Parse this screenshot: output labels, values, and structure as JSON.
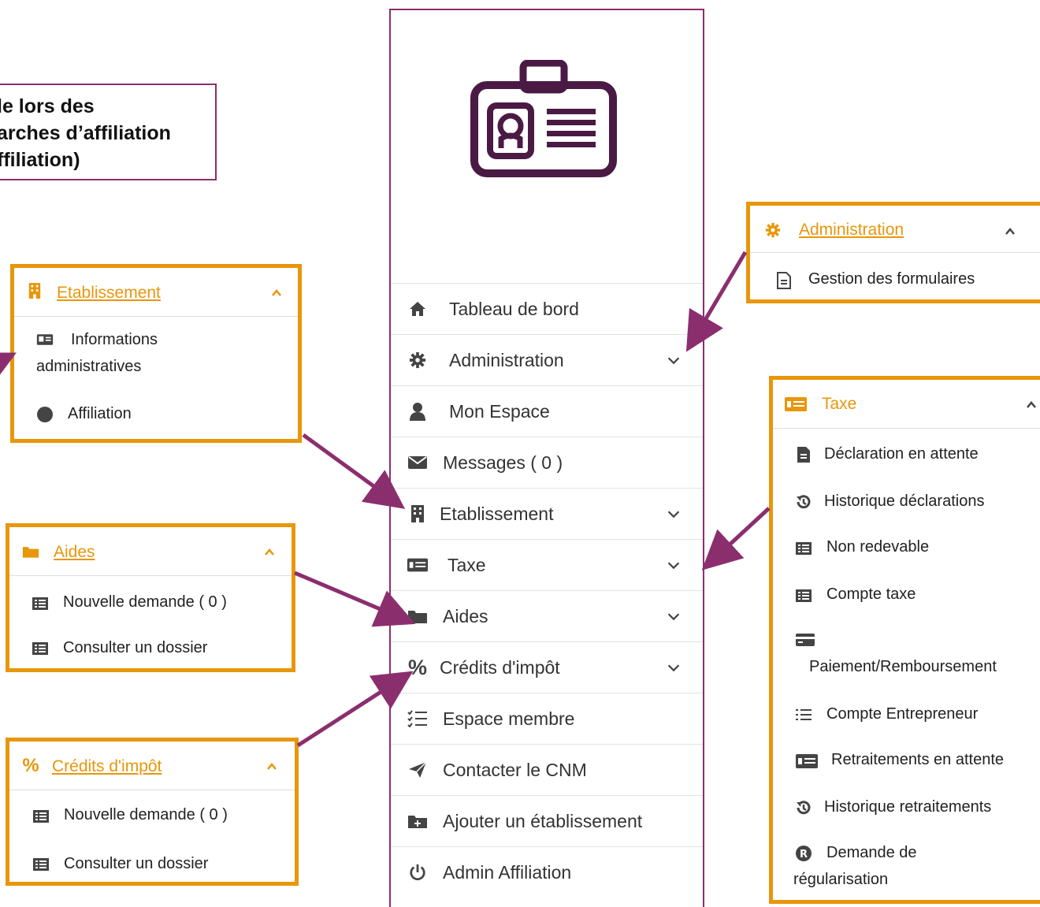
{
  "note": {
    "lines": [
      "le lors des",
      "arches d’affiliation",
      "ffiliation)"
    ]
  },
  "menu": {
    "logo_icon": "id-card-icon",
    "items": [
      {
        "label": "Tableau de bord",
        "icon": "home-icon",
        "has_chevron": false
      },
      {
        "label": "Administration",
        "icon": "gear-icon",
        "has_chevron": true
      },
      {
        "label": "Mon Espace",
        "icon": "user-icon",
        "has_chevron": false
      },
      {
        "label": "Messages ( 0 )",
        "icon": "envelope-icon",
        "has_chevron": false
      },
      {
        "label": "Etablissement",
        "icon": "building-icon",
        "has_chevron": true
      },
      {
        "label": "Taxe",
        "icon": "money-bill-icon",
        "has_chevron": true
      },
      {
        "label": "Aides",
        "icon": "folder-icon",
        "has_chevron": true
      },
      {
        "label": "Crédits d'impôt",
        "icon": "percent-icon",
        "has_chevron": true
      },
      {
        "label": "Espace membre",
        "icon": "list-check-icon",
        "has_chevron": false
      },
      {
        "label": "Contacter le CNM",
        "icon": "paper-plane-icon",
        "has_chevron": false
      },
      {
        "label": "Ajouter un établissement",
        "icon": "folder-plus-icon",
        "has_chevron": false
      },
      {
        "label": "Admin Affiliation",
        "icon": "power-icon",
        "has_chevron": false
      }
    ]
  },
  "panels": {
    "etablissement": {
      "title": "Etablissement",
      "icon": "building-icon",
      "items": [
        {
          "label_line1": "Informations",
          "label_line2": "administratives",
          "icon": "id-card-small-icon"
        },
        {
          "label": "Affiliation",
          "icon": "circle-icon"
        }
      ]
    },
    "aides": {
      "title": "Aides",
      "icon": "folder-icon",
      "items": [
        {
          "label": "Nouvelle demande ( 0 )",
          "icon": "table-list-icon"
        },
        {
          "label": "Consulter un dossier",
          "icon": "table-list-icon"
        }
      ]
    },
    "credits": {
      "title": "Crédits d'impôt",
      "icon": "percent-icon",
      "items": [
        {
          "label": "Nouvelle demande ( 0 )",
          "icon": "table-list-icon"
        },
        {
          "label": "Consulter un dossier",
          "icon": "table-list-icon"
        }
      ]
    },
    "administration": {
      "title": "Administration",
      "icon": "gear-icon",
      "items": [
        {
          "label": "Gestion des formulaires",
          "icon": "file-icon"
        }
      ]
    },
    "taxe": {
      "title": "Taxe",
      "icon": "money-bill-icon",
      "items": [
        {
          "label": "Déclaration en attente",
          "icon": "file-icon"
        },
        {
          "label": "Historique déclarations",
          "icon": "history-icon"
        },
        {
          "label": "Non redevable",
          "icon": "table-list-icon"
        },
        {
          "label": "Compte taxe",
          "icon": "table-list-icon"
        },
        {
          "label": "Paiement/Remboursement",
          "icon": "credit-card-icon"
        },
        {
          "label": "Compte Entrepreneur",
          "icon": "list-icon"
        },
        {
          "label": "Retraitements en attente",
          "icon": "money-bill-icon"
        },
        {
          "label": "Historique retraitements",
          "icon": "history-icon"
        },
        {
          "label_line1": "Demande de",
          "label_line2": "régularisation",
          "icon": "registered-icon"
        }
      ]
    }
  },
  "colors": {
    "accent_orange": "#e8960a",
    "arrow_purple": "#8b2e6e",
    "logo_purple": "#4a1a44",
    "icon_gray": "#444444"
  }
}
